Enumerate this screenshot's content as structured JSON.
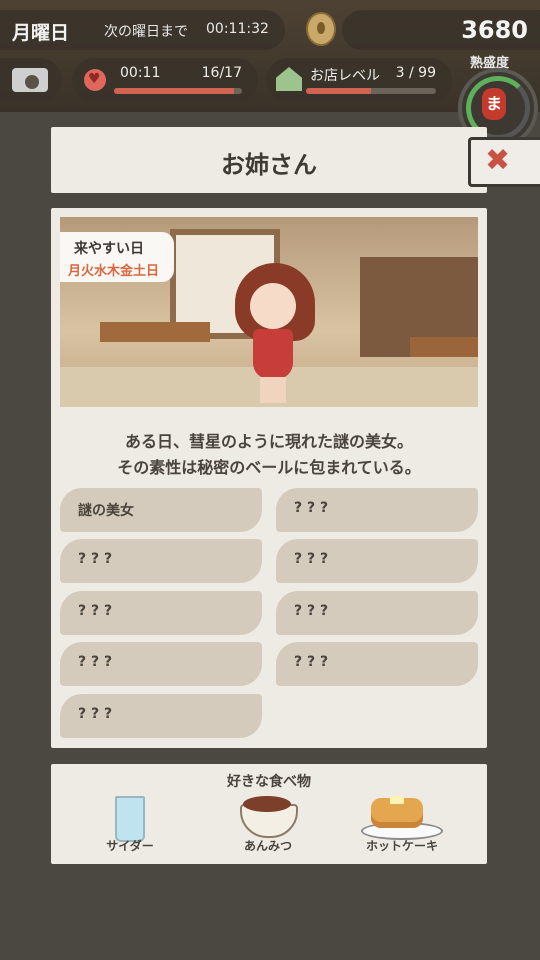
{
  "hud": {
    "day": "月曜日",
    "until_next_day_label": "次の曜日まで",
    "timer": "00:11:32",
    "money": "3680",
    "stamina_time": "00:11",
    "stamina_count": "16/17",
    "stamina_fraction": 0.94,
    "shop_level_label": "お店レベル",
    "shop_level": "3 / 99",
    "shop_level_fraction": 0.5,
    "mastery_label": "熟盛度",
    "mastery_lantern": "ま"
  },
  "profile": {
    "title": "お姉さん",
    "close_symbol": "✖",
    "visit_days_title": "来やすい日",
    "visit_days": "月火水木金土日",
    "description_line1": "ある日、彗星のように現れた謎の美女。",
    "description_line2": "その素性は秘密のベールに包まれている。",
    "traits": [
      "謎の美女",
      "? ? ?",
      "? ? ?",
      "? ? ?",
      "? ? ?",
      "? ? ?",
      "? ? ?",
      "? ? ?",
      "? ? ?"
    ]
  },
  "favorite_food": {
    "title": "好きな食べ物",
    "items": [
      {
        "name": "サイダー",
        "icon": "cider-glass-icon"
      },
      {
        "name": "あんみつ",
        "icon": "anmitsu-bowl-icon"
      },
      {
        "name": "ホットケーキ",
        "icon": "pancake-icon"
      }
    ]
  },
  "colors": {
    "accent_red": "#c85344",
    "days_orange": "#d9663d",
    "panel_bg": "#eeeae4",
    "chip_bg": "#d4cbbc"
  }
}
